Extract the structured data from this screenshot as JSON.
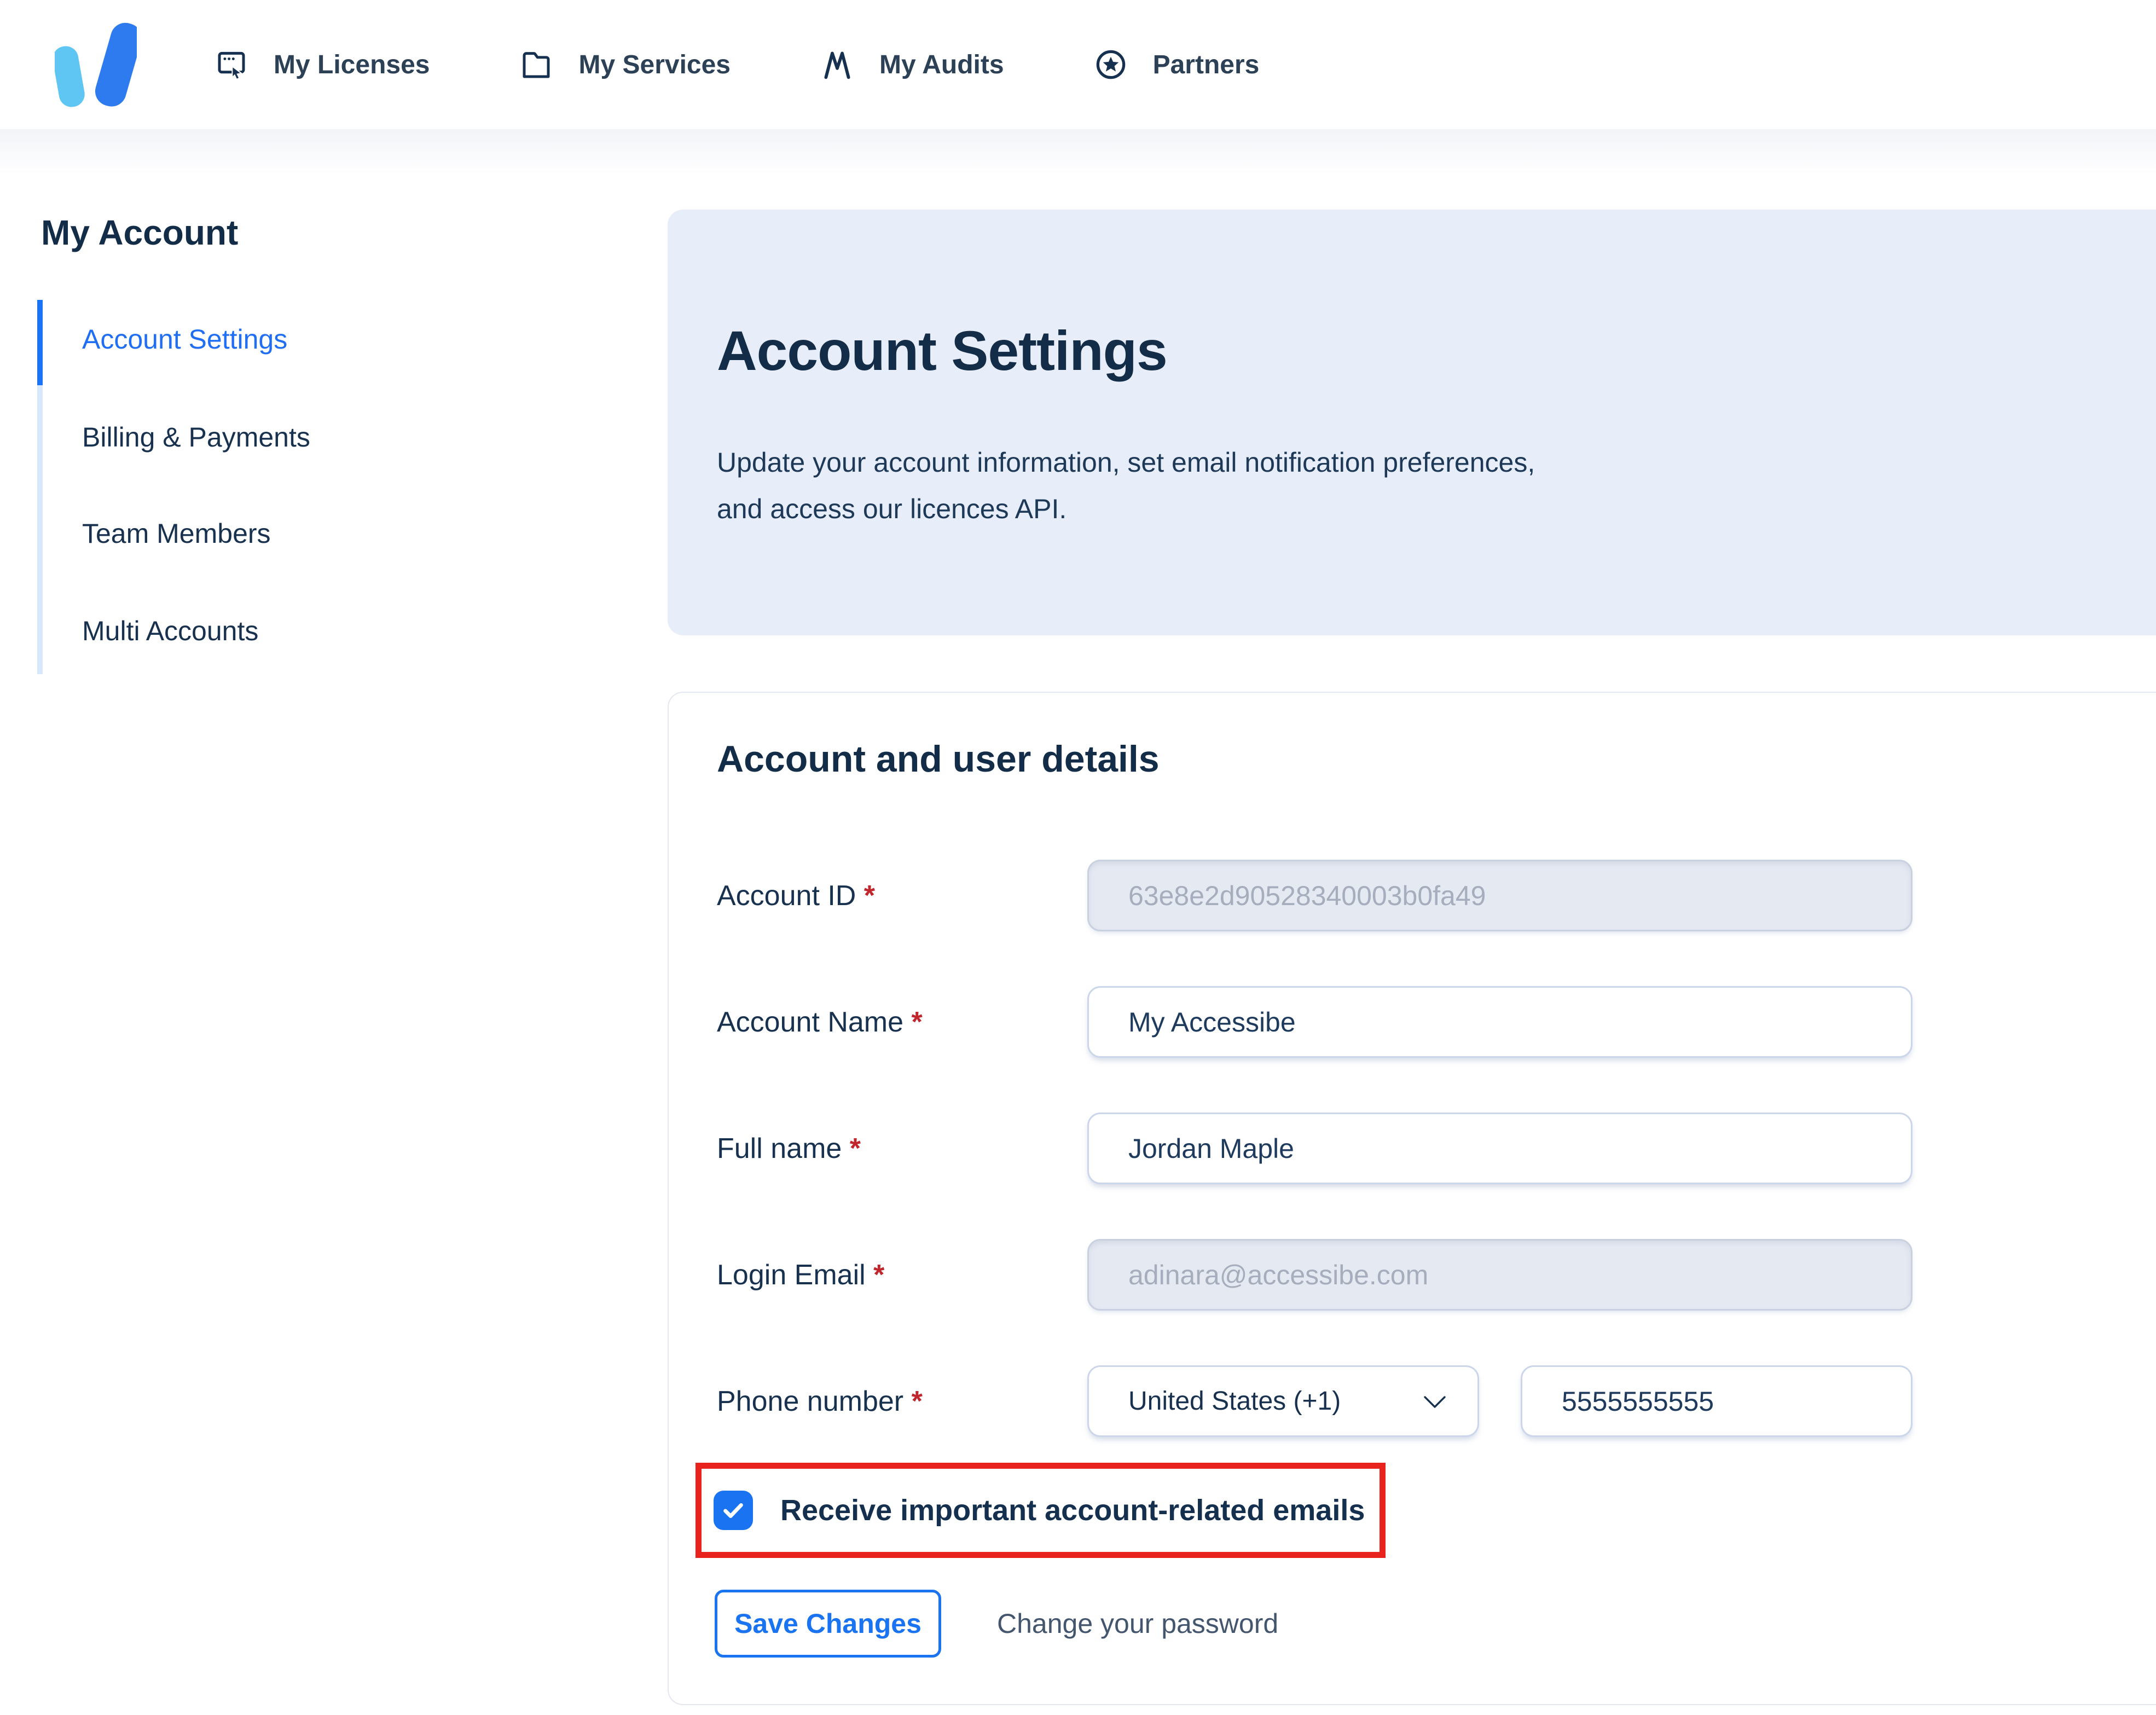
{
  "nav": {
    "items": [
      {
        "label": "My Licenses",
        "icon": "licenses-icon"
      },
      {
        "label": "My Services",
        "icon": "services-icon"
      },
      {
        "label": "My Audits",
        "icon": "audits-icon"
      },
      {
        "label": "Partners",
        "icon": "partners-icon"
      }
    ]
  },
  "sidebar": {
    "title": "My Account",
    "items": [
      {
        "label": "Account Settings",
        "active": true
      },
      {
        "label": "Billing & Payments",
        "active": false
      },
      {
        "label": "Team Members",
        "active": false
      },
      {
        "label": "Multi Accounts",
        "active": false
      }
    ]
  },
  "header": {
    "title": "Account Settings",
    "description": "Update your account information, set email notification preferences,\nand access our licences API."
  },
  "form": {
    "section_title": "Account and user details",
    "required_marker": "*",
    "fields": {
      "account_id": {
        "label": "Account ID",
        "value": "63e8e2d90528340003b0fa49",
        "disabled": true
      },
      "account_name": {
        "label": "Account Name",
        "value": "My Accessibe",
        "disabled": false
      },
      "full_name": {
        "label": "Full name",
        "value": "Jordan Maple",
        "disabled": false
      },
      "login_email": {
        "label": "Login Email",
        "value": "adinara@accessibe.com",
        "disabled": true
      },
      "phone": {
        "label": "Phone number",
        "country": "United States (+1)",
        "number": "5555555555"
      }
    },
    "checkbox": {
      "label": "Receive important account-related emails",
      "checked": true
    },
    "actions": {
      "save_label": "Save Changes",
      "change_password_label": "Change your password"
    }
  },
  "colors": {
    "accent_blue": "#1a73f0",
    "active_link_blue": "#1f6ef3",
    "navy_text": "#14304e",
    "header_card_bg": "#e8eef9",
    "highlight_red": "#e8231e",
    "required_red": "#c0262c",
    "disabled_bg": "#e5e9f2",
    "logo_light_blue": "#5fc6f3",
    "logo_blue": "#2173ee"
  }
}
